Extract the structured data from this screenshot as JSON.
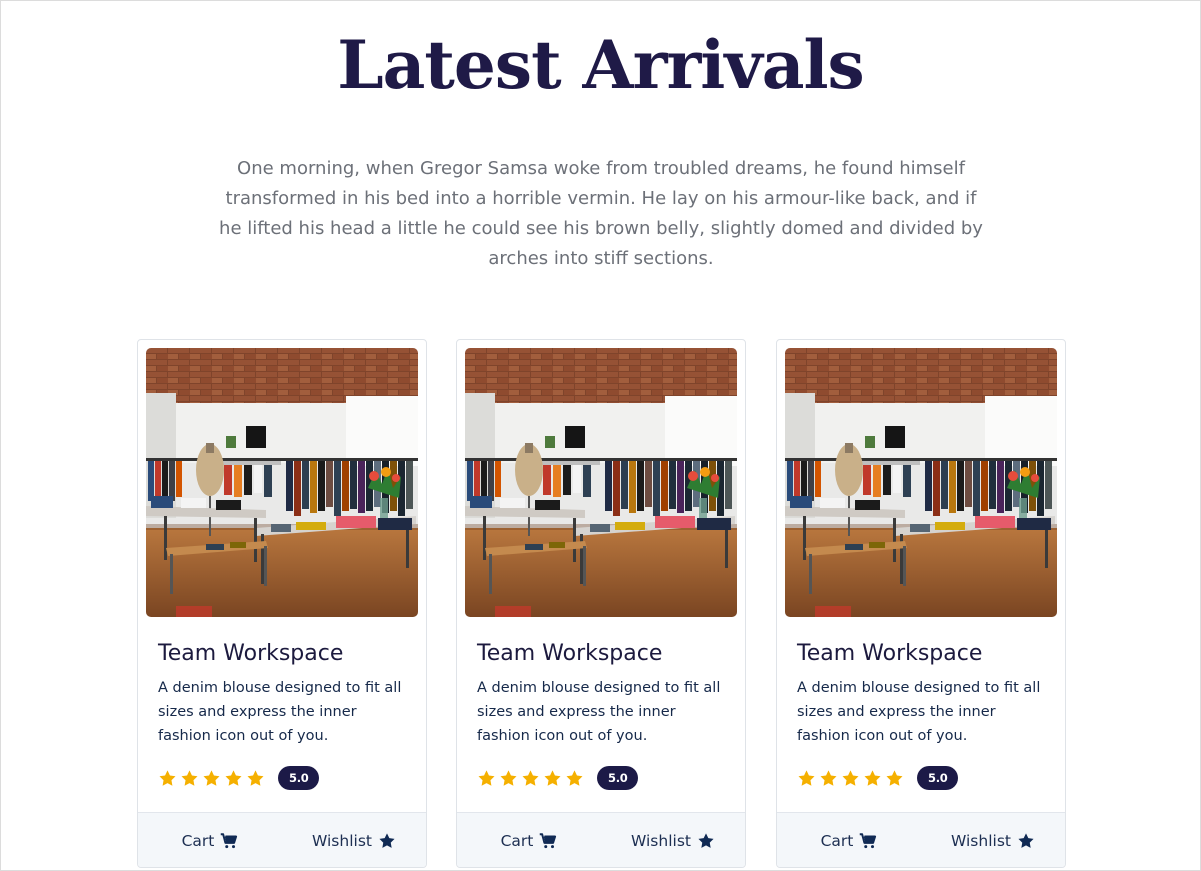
{
  "header": {
    "title": "Latest Arrivals",
    "intro": "One morning, when Gregor Samsa woke from troubled dreams, he found himself transformed in his bed into a horrible vermin. He lay on his armour-like back, and if he lifted his head a little he could see his brown belly, slightly domed and divided by arches into stiff sections."
  },
  "products": [
    {
      "title": "Team Workspace",
      "description": "A denim blouse designed to fit all sizes and express the inner fashion icon out of you.",
      "rating": 5,
      "rating_label": "5.0",
      "cart_label": "Cart",
      "wishlist_label": "Wishlist",
      "image_icon": "clothing-store-photo"
    },
    {
      "title": "Team Workspace",
      "description": "A denim blouse designed to fit all sizes and express the inner fashion icon out of you.",
      "rating": 5,
      "rating_label": "5.0",
      "cart_label": "Cart",
      "wishlist_label": "Wishlist",
      "image_icon": "clothing-store-photo"
    },
    {
      "title": "Team Workspace",
      "description": "A denim blouse designed to fit all sizes and express the inner fashion icon out of you.",
      "rating": 5,
      "rating_label": "5.0",
      "cart_label": "Cart",
      "wishlist_label": "Wishlist",
      "image_icon": "clothing-store-photo"
    }
  ],
  "colors": {
    "title": "#1f1a47",
    "star": "#f5b000",
    "badge": "#1c1a47",
    "footer_bg": "#f4f7fa",
    "icon": "#102a54"
  }
}
